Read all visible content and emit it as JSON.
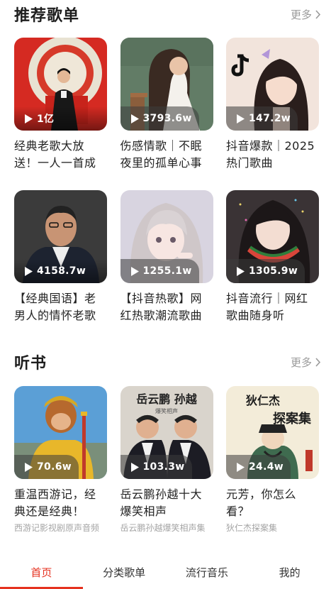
{
  "sections": [
    {
      "title": "推荐歌单",
      "more_label": "更多",
      "rows": [
        [
          {
            "count": "1亿",
            "title": "经典老歌大放送！一人一首成名曲"
          },
          {
            "count": "3793.6w",
            "title": "伤感情歌｜不眠夜里的孤单心事"
          },
          {
            "count": "147.2w",
            "title": "抖音爆款｜2025热门歌曲"
          }
        ],
        [
          {
            "count": "4158.7w",
            "title": "【经典国语】老男人的情怀老歌"
          },
          {
            "count": "1255.1w",
            "title": "【抖音热歌】网红热歌潮流歌曲"
          },
          {
            "count": "1305.9w",
            "title": "抖音流行｜网红歌曲随身听"
          }
        ]
      ]
    },
    {
      "title": "听书",
      "more_label": "更多",
      "rows": [
        [
          {
            "count": "70.6w",
            "title": "重温西游记，经典还是经典！",
            "subtitle": "西游记影视剧原声音频"
          },
          {
            "count": "103.3w",
            "title": "岳云鹏孙越十大爆笑相声",
            "subtitle": "岳云鹏孙越爆笑相声集"
          },
          {
            "count": "24.4w",
            "title": "元芳，你怎么看？",
            "subtitle": "狄仁杰探案集"
          }
        ]
      ]
    }
  ],
  "cover_text": {
    "yue_title": "岳云鹏 孙越",
    "yue_sub": "爆笑相声",
    "di_title_1": "狄仁杰",
    "di_title_2": "探案集"
  },
  "tabs": [
    {
      "label": "首页",
      "active": true
    },
    {
      "label": "分类歌单",
      "active": false
    },
    {
      "label": "流行音乐",
      "active": false
    },
    {
      "label": "我的",
      "active": false
    }
  ],
  "colors": {
    "accent": "#e5311f",
    "muted": "#9a9a9a"
  }
}
